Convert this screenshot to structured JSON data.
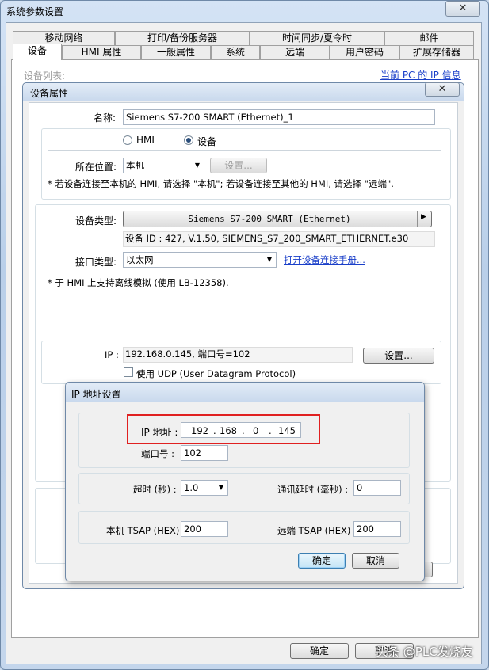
{
  "window": {
    "title": "系统参数设置",
    "close_glyph": "✕"
  },
  "tabs_row1": [
    "移动网络",
    "打印/备份服务器",
    "时间同步/夏令时",
    "邮件"
  ],
  "tabs_row2": [
    "设备",
    "HMI 属性",
    "一般属性",
    "系统",
    "远端",
    "用户密码",
    "扩展存储器"
  ],
  "page": {
    "device_list_label": "设备列表:",
    "ip_info_link": "当前 PC 的 IP 信息"
  },
  "device_props": {
    "title": "设备属性",
    "name_label": "名称:",
    "name_value": "Siemens S7-200 SMART (Ethernet)_1",
    "radio_hmi": "HMI",
    "radio_device": "设备",
    "location_label": "所在位置:",
    "location_value": "本机",
    "location_settings_btn": "设置...",
    "location_note": "* 若设备连接至本机的 HMI, 请选择 \"本机\"; 若设备连接至其他的 HMI, 请选择 \"远端\".",
    "device_type_label": "设备类型:",
    "device_type_value": "Siemens S7-200 SMART (Ethernet)",
    "device_id": "设备 ID : 427, V.1.50, SIEMENS_S7_200_SMART_ETHERNET.e30",
    "interface_label": "接口类型:",
    "interface_value": "以太网",
    "manual_link": "打开设备连接手册...",
    "offline_note": "* 于 HMI 上支持离线模拟 (使用 LB-12358).",
    "ip_label": "IP :",
    "ip_value": "192.168.0.145, 端口号=102",
    "ip_settings_btn": "设置...",
    "udp_label": "使用 UDP (User Datagram Protocol)"
  },
  "ip_dialog": {
    "title": "IP 地址设置",
    "ip_label": "IP 地址 :",
    "ip_octets": [
      "192",
      "168",
      "0",
      "145"
    ],
    "port_label": "端口号 :",
    "port_value": "102",
    "timeout_label": "超时 (秒) :",
    "timeout_value": "1.0",
    "delay_label": "通讯延时 (毫秒) :",
    "delay_value": "0",
    "local_tsap_label": "本机 TSAP (HEX) :",
    "local_tsap_value": "200",
    "remote_tsap_label": "远端 TSAP (HEX) :",
    "remote_tsap_value": "200",
    "ok_btn": "确定",
    "cancel_btn": "取消"
  },
  "footer": {
    "ok_btn": "确定",
    "cancel_btn": "取消"
  },
  "watermark": "头条 @PLC发烧友"
}
